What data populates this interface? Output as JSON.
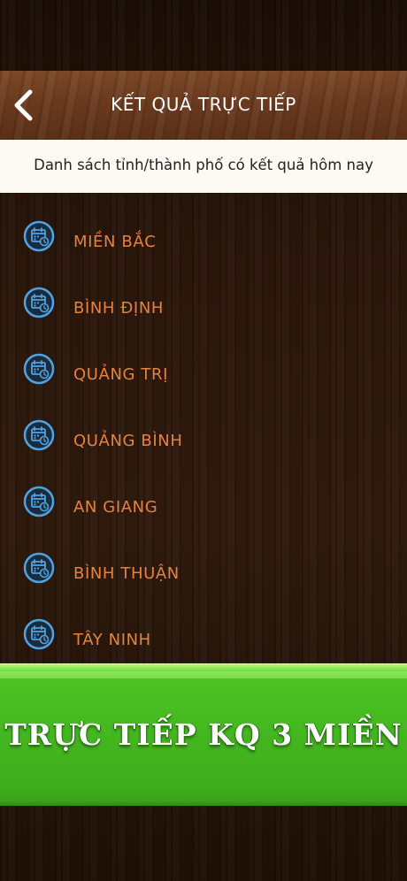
{
  "header": {
    "title": "KẾT QUẢ TRỰC TIẾP",
    "back_icon": "chevron-left-icon"
  },
  "subtitle": "Danh sách tỉnh/thành phố có kết quả hôm nay",
  "list": {
    "item_icon": "calendar-clock-icon",
    "items": [
      {
        "label": "MIỀN BẮC"
      },
      {
        "label": "BÌNH ĐỊNH"
      },
      {
        "label": "QUẢNG TRỊ"
      },
      {
        "label": "QUẢNG BÌNH"
      },
      {
        "label": "AN GIANG"
      },
      {
        "label": "BÌNH THUẬN"
      },
      {
        "label": "TÂY NINH"
      }
    ]
  },
  "banner": {
    "label": "TRỰC TIẾP KQ 3 MIỀN"
  },
  "colors": {
    "item_label": "#e8823a",
    "icon_ring": "#4fa3e3",
    "banner_green": "#43b71f"
  }
}
